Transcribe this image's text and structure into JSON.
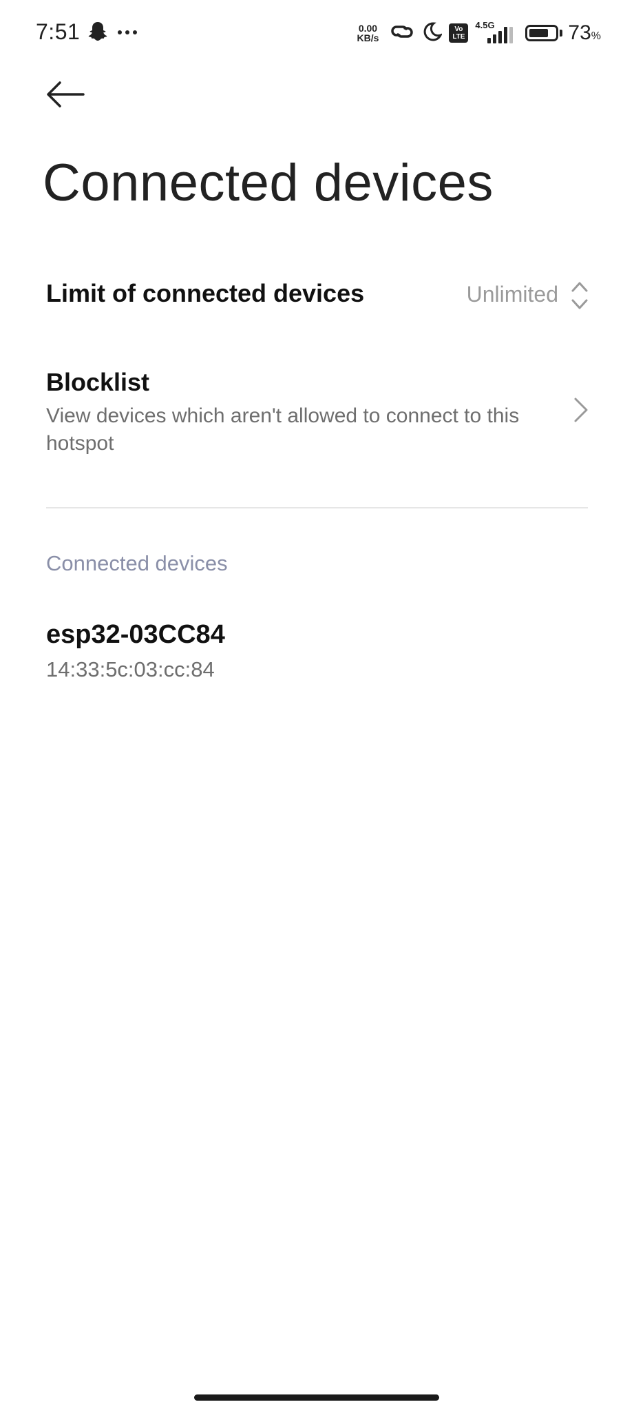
{
  "status_bar": {
    "time": "7:51",
    "net_speed_value": "0.00",
    "net_speed_unit": "KB/s",
    "volte_top": "Vo",
    "volte_bottom": "LTE",
    "network_type": "4.5G",
    "battery_percent": "73",
    "battery_unit": "%",
    "battery_level": 0.73,
    "icons": [
      "snapchat-ghost-icon",
      "more-dots-icon",
      "link-icon",
      "moon-icon",
      "signal-icon",
      "battery-icon"
    ]
  },
  "header": {
    "back_icon": "arrow-left-icon",
    "title": "Connected devices"
  },
  "settings": {
    "limit": {
      "label": "Limit of connected devices",
      "value": "Unlimited",
      "icon": "up-down-chevron-icon"
    },
    "blocklist": {
      "label": "Blocklist",
      "description": "View devices which aren't allowed to connect to this hotspot",
      "icon": "chevron-right-icon"
    }
  },
  "connected_section": {
    "header": "Connected devices",
    "devices": [
      {
        "name": "esp32-03CC84",
        "mac": "14:33:5c:03:cc:84"
      }
    ]
  },
  "colors": {
    "background": "#ffffff",
    "primary_text": "#111111",
    "secondary_text": "#6e6e6e",
    "value_text": "#9a9a9a",
    "section_header": "#8a8fa8",
    "divider": "#e6e6e6"
  }
}
